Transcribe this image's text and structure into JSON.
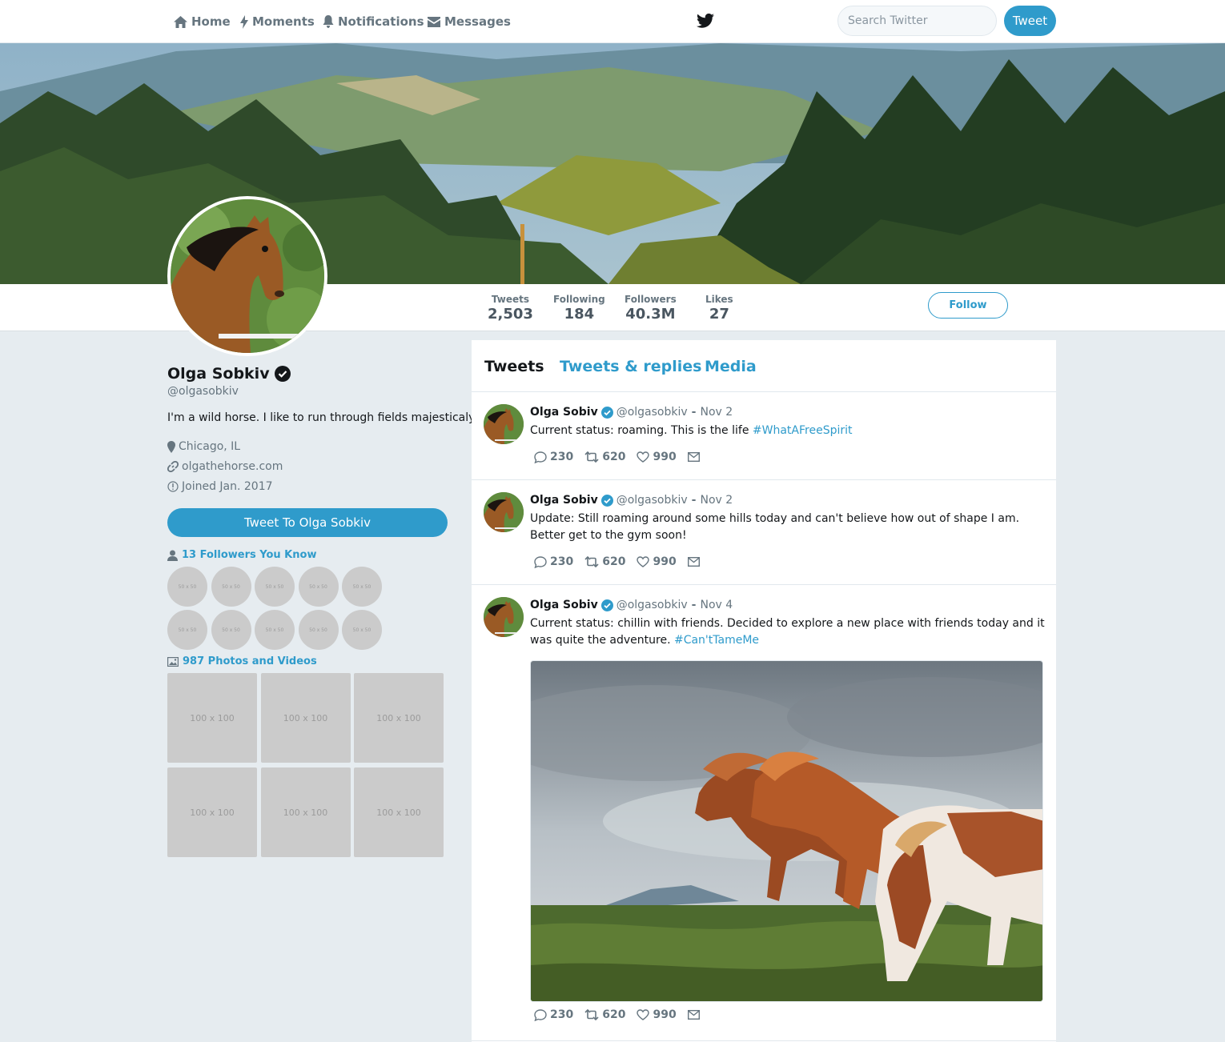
{
  "nav": {
    "home": "Home",
    "moments": "Moments",
    "notifications": "Notifications",
    "messages": "Messages",
    "search_placeholder": "Search Twitter",
    "tweet_button": "Tweet"
  },
  "stats": [
    {
      "label": "Tweets",
      "value": "2,503"
    },
    {
      "label": "Following",
      "value": "184"
    },
    {
      "label": "Followers",
      "value": "40.3M"
    },
    {
      "label": "Likes",
      "value": "27"
    }
  ],
  "follow_button": "Follow",
  "profile": {
    "name": "Olga Sobkiv",
    "handle": "@olgasobkiv",
    "bio": "I'm a wild horse. I like to run through fields majesticaly.",
    "location": "Chicago, IL",
    "website": "olgathehorse.com",
    "joined": "Joined Jan. 2017",
    "tweet_to": "Tweet To Olga Sobkiv",
    "followers_you_know": "13 Followers You Know",
    "photos_videos": "987 Photos and Videos",
    "follower_placeholder": "50 x 50",
    "photo_placeholder": "100 x 100"
  },
  "tabs": {
    "tweets": "Tweets",
    "replies": "Tweets & replies",
    "media": "Media"
  },
  "tweets": [
    {
      "name": "Olga Sobiv",
      "handle": "@olgasobkiv",
      "sep": "-",
      "date": "Nov 2",
      "text": "Current status: roaming. This is the life ",
      "hashtag": "#WhatAFreeSpirit",
      "replies": "230",
      "retweets": "620",
      "likes": "990"
    },
    {
      "name": "Olga Sobiv",
      "handle": "@olgasobkiv",
      "sep": "-",
      "date": "Nov 2",
      "text": "Update: Still roaming around some hills today and can't believe how out of shape I am. Better get to the gym soon!",
      "replies": "230",
      "retweets": "620",
      "likes": "990"
    },
    {
      "name": "Olga Sobiv",
      "handle": "@olgasobkiv",
      "sep": "-",
      "date": "Nov 4",
      "text": "Current status: chillin with friends. Decided to explore a new place with friends today and it was quite the adventure. ",
      "hashtag": "#Can'tTameMe",
      "replies": "230",
      "retweets": "620",
      "likes": "990"
    }
  ],
  "colors": {
    "accent": "#2f9bcb",
    "background": "#e6ecf0",
    "muted": "#66757f"
  }
}
